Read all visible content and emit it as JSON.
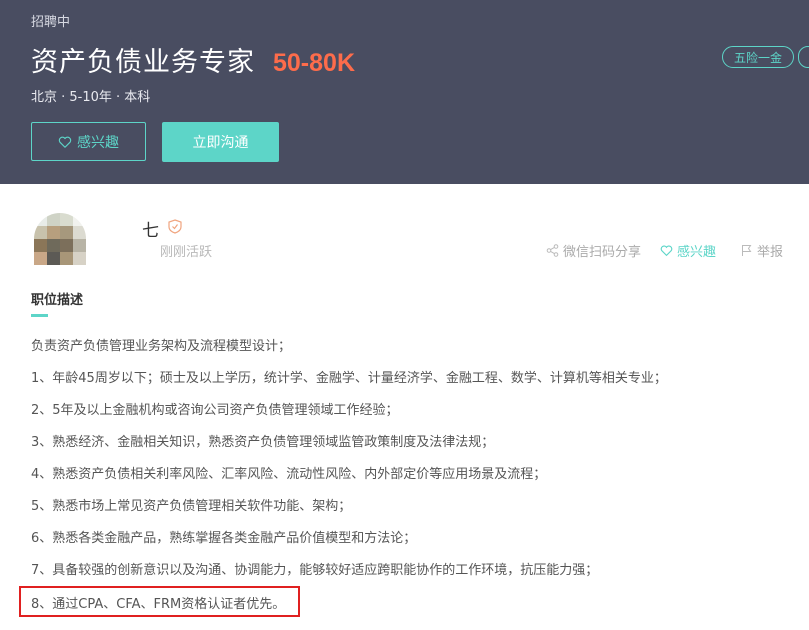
{
  "job": {
    "status": "招聘中",
    "title": "资产负债业务专家",
    "salary": "50-80K",
    "meta": "北京 · 5-10年 · 本科",
    "interest_button": "感兴趣",
    "chat_button": "立即沟通",
    "benefit_tag": "五险一金"
  },
  "recruiter": {
    "name": "七",
    "status": "刚刚活跃",
    "actions": {
      "share": "微信扫码分享",
      "interest": "感兴趣",
      "report": "举报"
    }
  },
  "description": {
    "heading": "职位描述",
    "lines": [
      "负责资产负债管理业务架构及流程模型设计；",
      "1、年龄45周岁以下；硕士及以上学历，统计学、金融学、计量经济学、金融工程、数学、计算机等相关专业；",
      "2、5年及以上金融机构或咨询公司资产负债管理领域工作经验；",
      "3、熟悉经济、金融相关知识，熟悉资产负债管理领域监管政策制度及法律法规；",
      "4、熟悉资产负债相关利率风险、汇率风险、流动性风险、内外部定价等应用场景及流程；",
      "5、熟悉市场上常见资产负债管理相关软件功能、架构；",
      "6、熟悉各类金融产品，熟练掌握各类金融产品价值模型和方法论；",
      "7、具备较强的创新意识以及沟通、协调能力，能够较好适应跨职能协作的工作环境，抗压能力强；",
      "8、通过CPA、CFA、FRM资格认证者优先。"
    ]
  },
  "colors": {
    "banner": "#494d61",
    "accent": "#5dd5c8",
    "salary": "#fd6c4b",
    "highlight": "#e02020"
  }
}
